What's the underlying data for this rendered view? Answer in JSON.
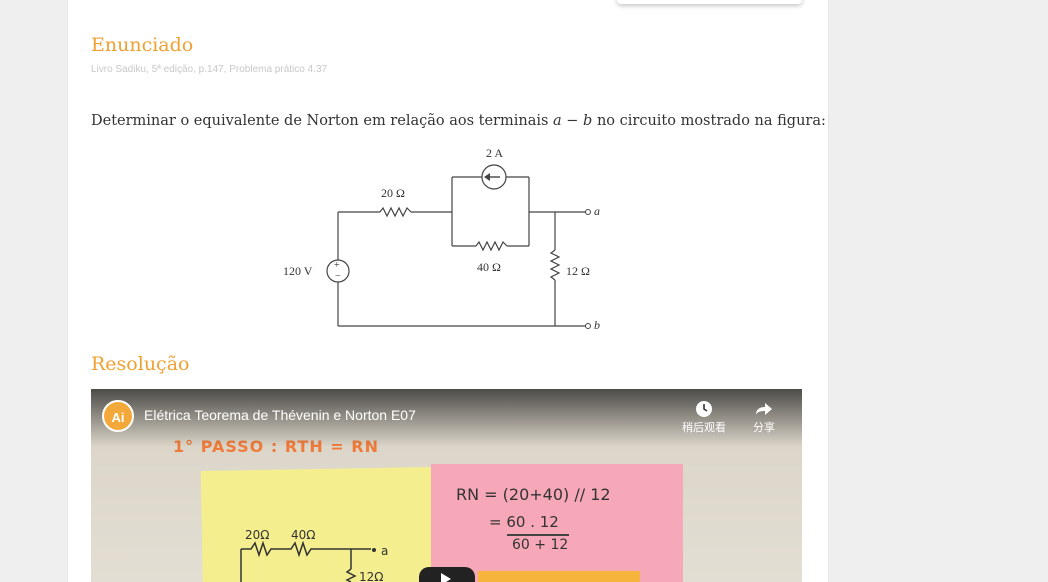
{
  "section1": {
    "title": "Enunciado",
    "subtitle": "Livro Sadiku, 5ª edição, p.147, Problema prático 4.37"
  },
  "statement": {
    "before": "Determinar o equivalente de Norton em relação aos terminais ",
    "math": "a − b",
    "after": " no circuito mostrado na figura:"
  },
  "circuit": {
    "source_label": "120 V",
    "current_source_label": "2 A",
    "r1_label": "20 Ω",
    "r2_label": "40 Ω",
    "r3_label": "12 Ω",
    "terminal_a": "a",
    "terminal_b": "b",
    "plus_sign": "+",
    "minus_sign": "−"
  },
  "section2": {
    "title": "Resolução"
  },
  "video": {
    "channel_logo_text": "Ai",
    "title": "Elétrica Teorema de Thévenin e Norton E07",
    "watch_later_label": "稍后观看",
    "share_label": "分享",
    "frame_texts": {
      "passo": "1° PASSO : RTH = RN",
      "rn_line1": "RN = (20+40) // 12",
      "rn_line2": "= 60 . 12",
      "rn_line3": "60 + 12",
      "sketch_r1": "20Ω",
      "sketch_r2": "40Ω",
      "sketch_r3": "12Ω",
      "sketch_a": "a"
    }
  }
}
